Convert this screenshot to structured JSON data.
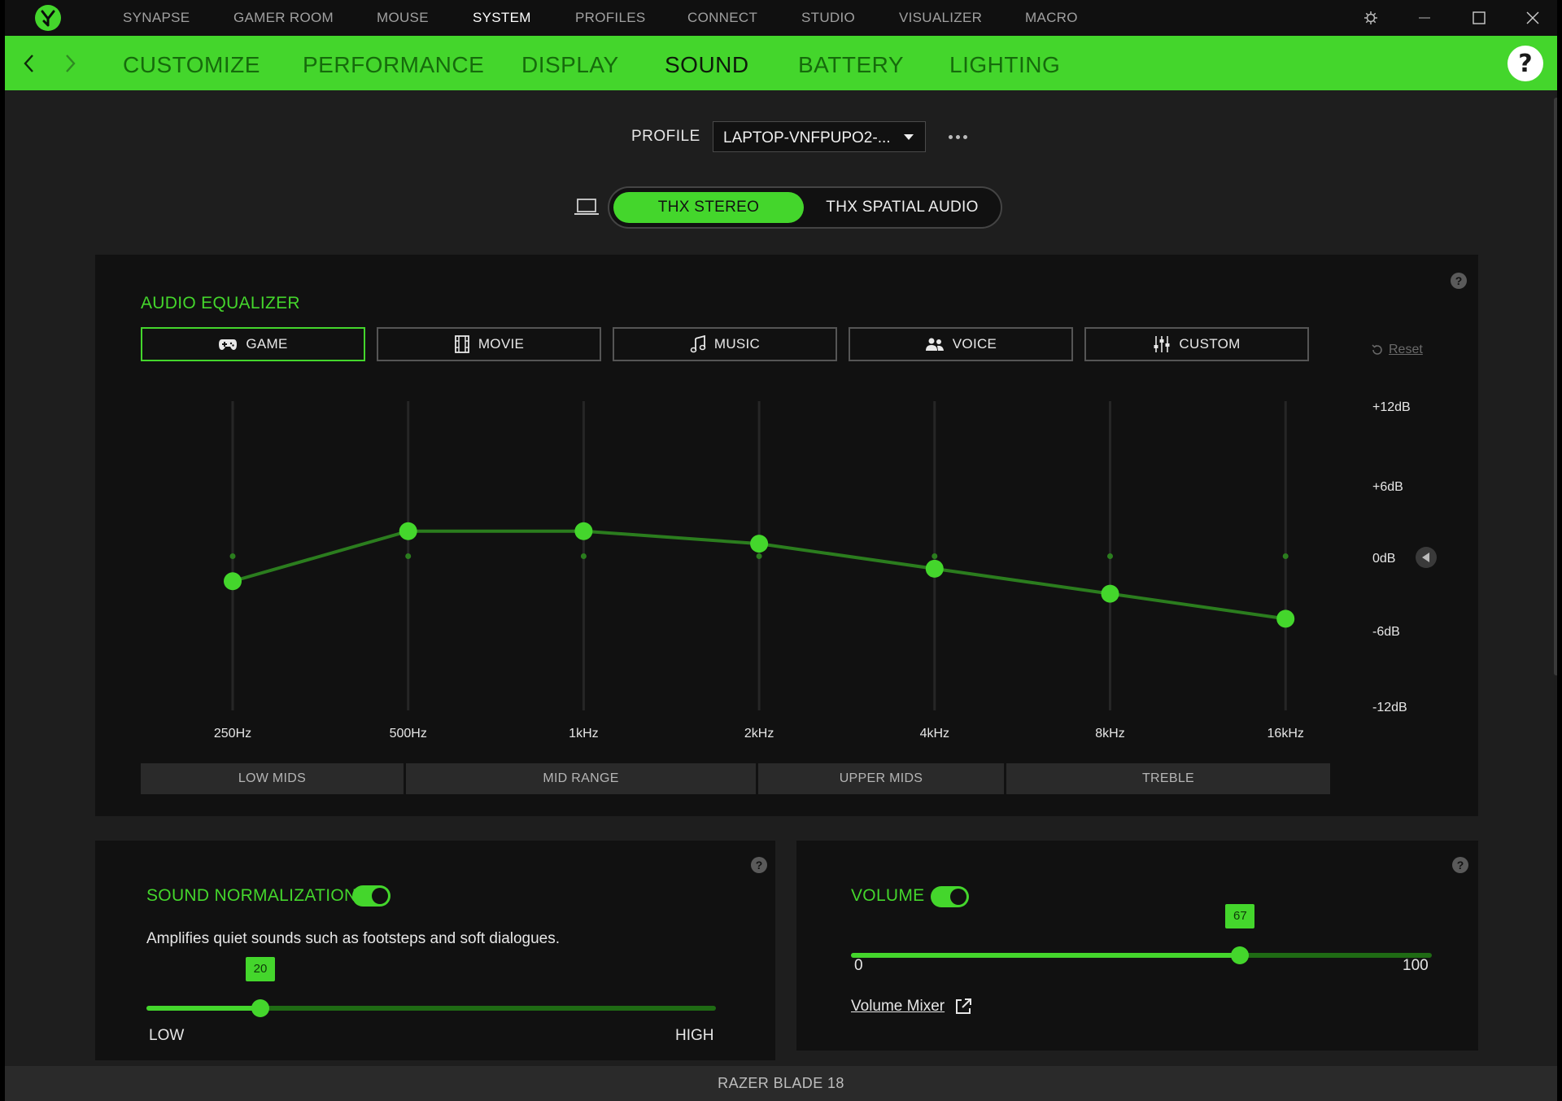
{
  "topnav": {
    "items": [
      {
        "label": "SYNAPSE",
        "active": false
      },
      {
        "label": "GAMER ROOM",
        "active": false
      },
      {
        "label": "MOUSE",
        "active": false
      },
      {
        "label": "SYSTEM",
        "active": true
      },
      {
        "label": "PROFILES",
        "active": false
      },
      {
        "label": "CONNECT",
        "active": false
      },
      {
        "label": "STUDIO",
        "active": false
      },
      {
        "label": "VISUALIZER",
        "active": false
      },
      {
        "label": "MACRO",
        "active": false
      }
    ],
    "icons": [
      "razer-logo-icon",
      "settings-gear-icon",
      "minimize-icon",
      "maximize-icon",
      "close-icon"
    ]
  },
  "subnav": {
    "tabs": [
      {
        "label": "CUSTOMIZE",
        "active": false
      },
      {
        "label": "PERFORMANCE",
        "active": false
      },
      {
        "label": "DISPLAY",
        "active": false
      },
      {
        "label": "SOUND",
        "active": true
      },
      {
        "label": "BATTERY",
        "active": false
      },
      {
        "label": "LIGHTING",
        "active": false
      }
    ],
    "help": "?"
  },
  "profile": {
    "label": "PROFILE",
    "value": "LAPTOP-VNFPUPO2-..."
  },
  "audio_mode": {
    "options": [
      "THX STEREO",
      "THX SPATIAL AUDIO"
    ],
    "selected": "THX STEREO"
  },
  "equalizer": {
    "title": "AUDIO EQUALIZER",
    "help": "?",
    "presets": [
      {
        "label": "GAME",
        "icon": "gamepad-icon",
        "active": true
      },
      {
        "label": "MOVIE",
        "icon": "film-icon",
        "active": false
      },
      {
        "label": "MUSIC",
        "icon": "music-note-icon",
        "active": false
      },
      {
        "label": "VOICE",
        "icon": "people-icon",
        "active": false
      },
      {
        "label": "CUSTOM",
        "icon": "sliders-icon",
        "active": false
      }
    ],
    "reset_label": "Reset",
    "db_labels": [
      "+12dB",
      "+6dB",
      "0dB",
      "-6dB",
      "-12dB"
    ],
    "db_range": [
      -12,
      12
    ],
    "frequencies": [
      "250Hz",
      "500Hz",
      "1kHz",
      "2kHz",
      "4kHz",
      "8kHz",
      "16kHz"
    ],
    "gains_db": [
      -2,
      2,
      2,
      1,
      -1,
      -3,
      -5
    ],
    "bands": [
      "LOW MIDS",
      "MID RANGE",
      "UPPER MIDS",
      "TREBLE"
    ],
    "accent": "#44d62c"
  },
  "normalization": {
    "title": "SOUND NORMALIZATION",
    "enabled": true,
    "description": "Amplifies quiet sounds such as footsteps and soft dialogues.",
    "value": 20,
    "value_label": "20",
    "fraction": 0.2,
    "min_label": "LOW",
    "max_label": "HIGH",
    "help": "?"
  },
  "volume": {
    "title": "VOLUME",
    "enabled": true,
    "value": 67,
    "value_label": "67",
    "min": 0,
    "max": 100,
    "min_label": "0",
    "max_label": "100",
    "mixer_label": "Volume Mixer",
    "help": "?"
  },
  "status_bar": "RAZER BLADE 18"
}
